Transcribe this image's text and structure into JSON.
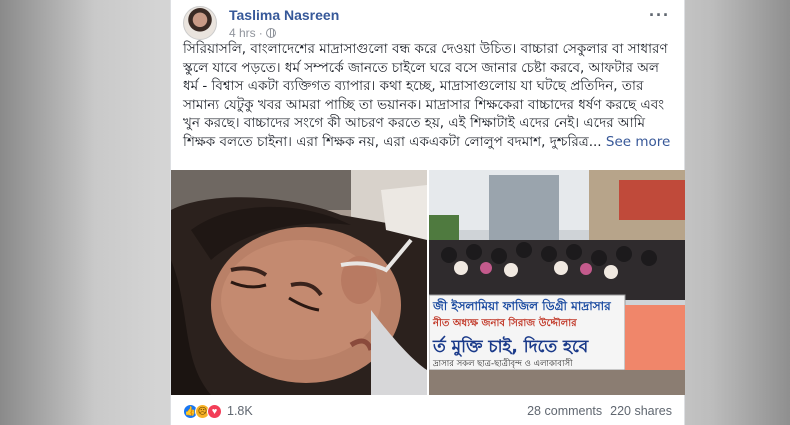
{
  "post": {
    "author": "Taslima Nasreen",
    "time": "4 hrs",
    "privacy_icon": "globe-icon",
    "menu_icon": "more-options-icon",
    "text": "সিরিয়াসলি, বাংলাদেশের মাদ্রাসাগুলো বন্ধ করে দেওয়া উচিত। বাচ্চারা সেকুলার বা সাধারণ স্কুলে যাবে পড়তে। ধর্ম সম্পর্কে জানতে চাইলে ঘরে বসে জানার চেষ্টা করবে, আফটার অল ধর্ম - বিশ্বাস একটা ব্যক্তিগত ব্যাপার। কথা হচ্ছে, মাদ্রাসাগুলোয় যা ঘটছে প্রতিদিন, তার সামান্য যেটুকু খবর আমরা পাচ্ছি তা ভয়ানক। মাদ্রাসার শিক্ষকেরা বাচ্চাদের ধর্ষণ করছে এবং খুন করছে। বাচ্চাদের সংগে কী আচরণ করতে হয়, এই শিক্ষাটাই এদের নেই। এদের আমি শিক্ষক বলতে চাইনা। এরা শিক্ষক নয়, এরা একএকটা লোলুপ বদমাশ, দুশ্চরিত্র...",
    "see_more": "See more"
  },
  "photos": {
    "banner_line1": "জী ইসলামিয়া ফাজিল ডিগ্রী মাদ্রাসার",
    "banner_line2": "নীত অধ্যক্ষ জনাব সিরাজ উদ্দৌলার",
    "banner_line3": "র্ত মুক্তি চাই, দিতে হবে",
    "banner_line4": "দ্রাসার সকল ছাত্র-ছাত্রীবৃন্দ ও এলাকাবাসী"
  },
  "footer": {
    "reaction_icons": [
      "like-icon",
      "sad-icon",
      "love-icon"
    ],
    "reaction_count": "1.8K",
    "comments": "28 comments",
    "shares": "220 shares"
  }
}
